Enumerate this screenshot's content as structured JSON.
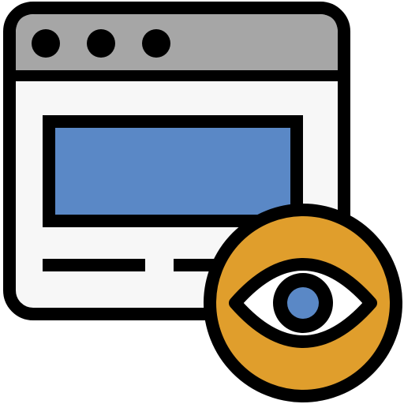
{
  "icon": {
    "name": "browser-preview-eye-icon",
    "colors": {
      "outline": "#000000",
      "titlebar": "#A6A6A6",
      "window": "#F7F7F7",
      "content": "#5A88C6",
      "badge": "#E09E2C",
      "eye_white": "#FFFFFF",
      "iris": "#5A88C6"
    }
  }
}
